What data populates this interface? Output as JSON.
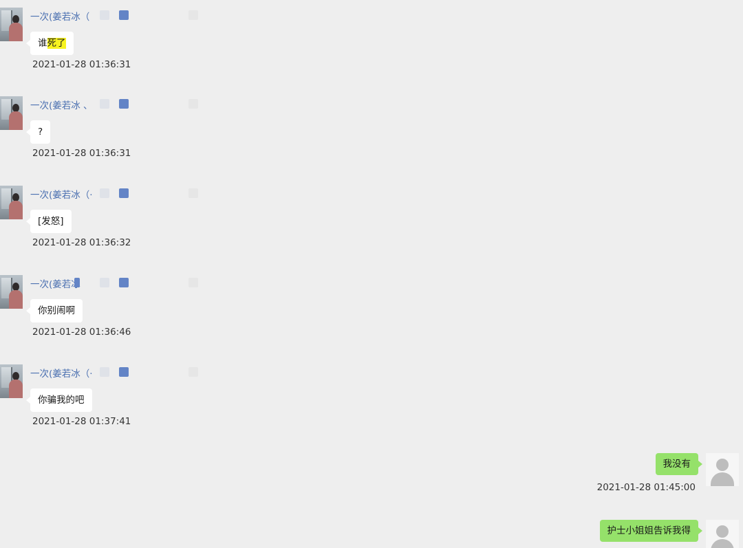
{
  "chat": {
    "incoming": [
      {
        "sender": "一次(姜若冰（",
        "text_before": "谁",
        "text_highlight": "死了",
        "time": "2021-01-28 01:36:31"
      },
      {
        "sender": "一次(姜若冰 、",
        "text": "?",
        "time": "2021-01-28 01:36:31"
      },
      {
        "sender": "一次(姜若冰（·",
        "text": "[发怒]",
        "time": "2021-01-28 01:36:32"
      },
      {
        "sender": "一次(姜若冰",
        "text": "你别闹啊",
        "time": "2021-01-28 01:36:46"
      },
      {
        "sender": "一次(姜若冰（·",
        "text": "你骗我的吧",
        "time": "2021-01-28 01:37:41"
      }
    ],
    "outgoing": [
      {
        "text": "我没有",
        "time": "2021-01-28 01:45:00"
      },
      {
        "text": "护士小姐姐告诉我得",
        "time": ""
      }
    ],
    "colors": {
      "background": "#eeeeee",
      "incoming_bubble": "#ffffff",
      "outgoing_bubble": "#95e16a",
      "sender_name": "#4a6fb0",
      "highlight": "#f7f31f"
    }
  }
}
